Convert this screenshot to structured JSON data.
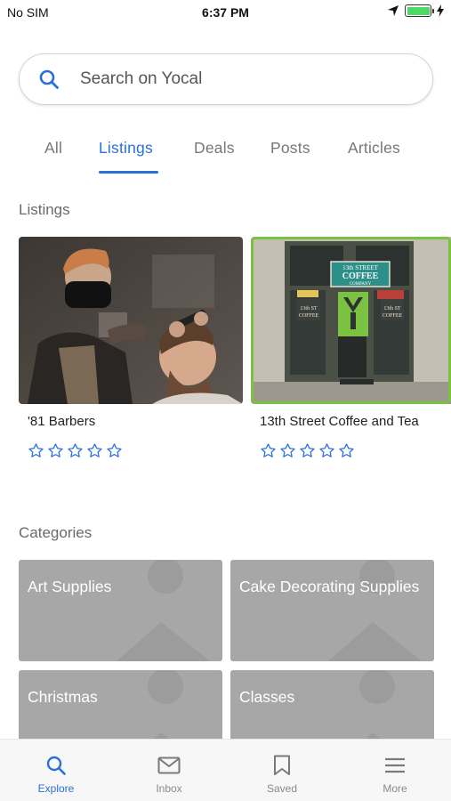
{
  "status_bar": {
    "carrier": "No SIM",
    "time": "6:37 PM"
  },
  "search": {
    "placeholder": "Search on Yocal"
  },
  "tabs": [
    {
      "label": "All",
      "active": false
    },
    {
      "label": "Listings",
      "active": true
    },
    {
      "label": "Deals",
      "active": false
    },
    {
      "label": "Posts",
      "active": false
    },
    {
      "label": "Articles",
      "active": false
    }
  ],
  "listings_section": {
    "title": "Listings",
    "items": [
      {
        "name": "'81 Barbers",
        "rating": 0,
        "max_rating": 5
      },
      {
        "name": "13th Street Coffee and Tea",
        "rating": 0,
        "max_rating": 5,
        "sign_lines": [
          "13th STREET",
          "COFFEE",
          "COMPANY"
        ]
      }
    ]
  },
  "categories_section": {
    "title": "Categories",
    "items": [
      {
        "label": "Art Supplies"
      },
      {
        "label": "Cake Decorating Supplies"
      },
      {
        "label": "Christmas"
      },
      {
        "label": "Classes"
      }
    ]
  },
  "bottom_nav": [
    {
      "label": "Explore",
      "icon": "search-icon",
      "active": true
    },
    {
      "label": "Inbox",
      "icon": "mail-icon",
      "active": false
    },
    {
      "label": "Saved",
      "icon": "bookmark-icon",
      "active": false
    },
    {
      "label": "More",
      "icon": "menu-icon",
      "active": false
    }
  ],
  "colors": {
    "accent": "#2a6fdb",
    "category_tile": "#a7a7a7",
    "battery": "#4cd964",
    "highlight_border": "#7cc242"
  }
}
